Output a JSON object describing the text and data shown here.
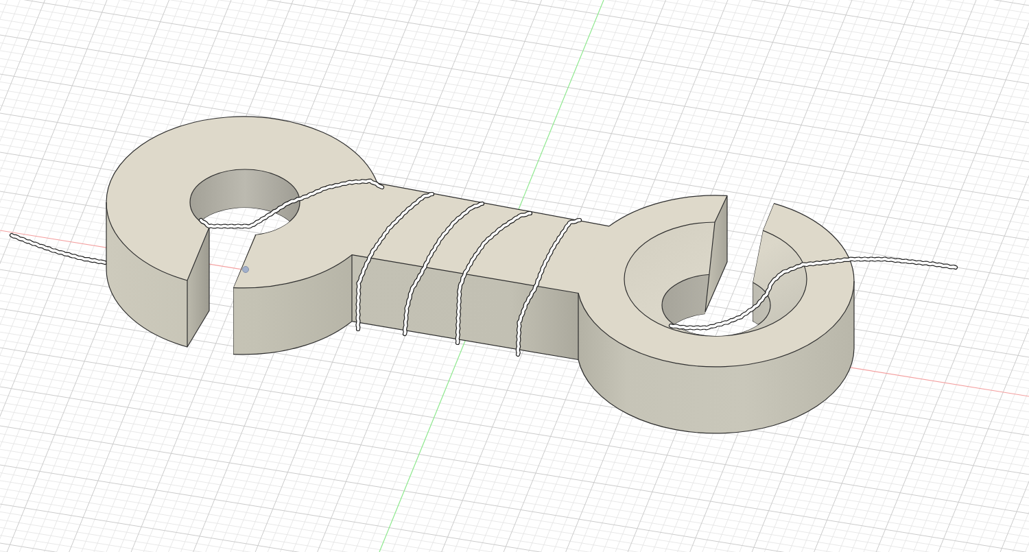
{
  "axes": [
    {
      "color": "#f4a0a0"
    },
    {
      "color": "#8ee88e"
    }
  ]
}
